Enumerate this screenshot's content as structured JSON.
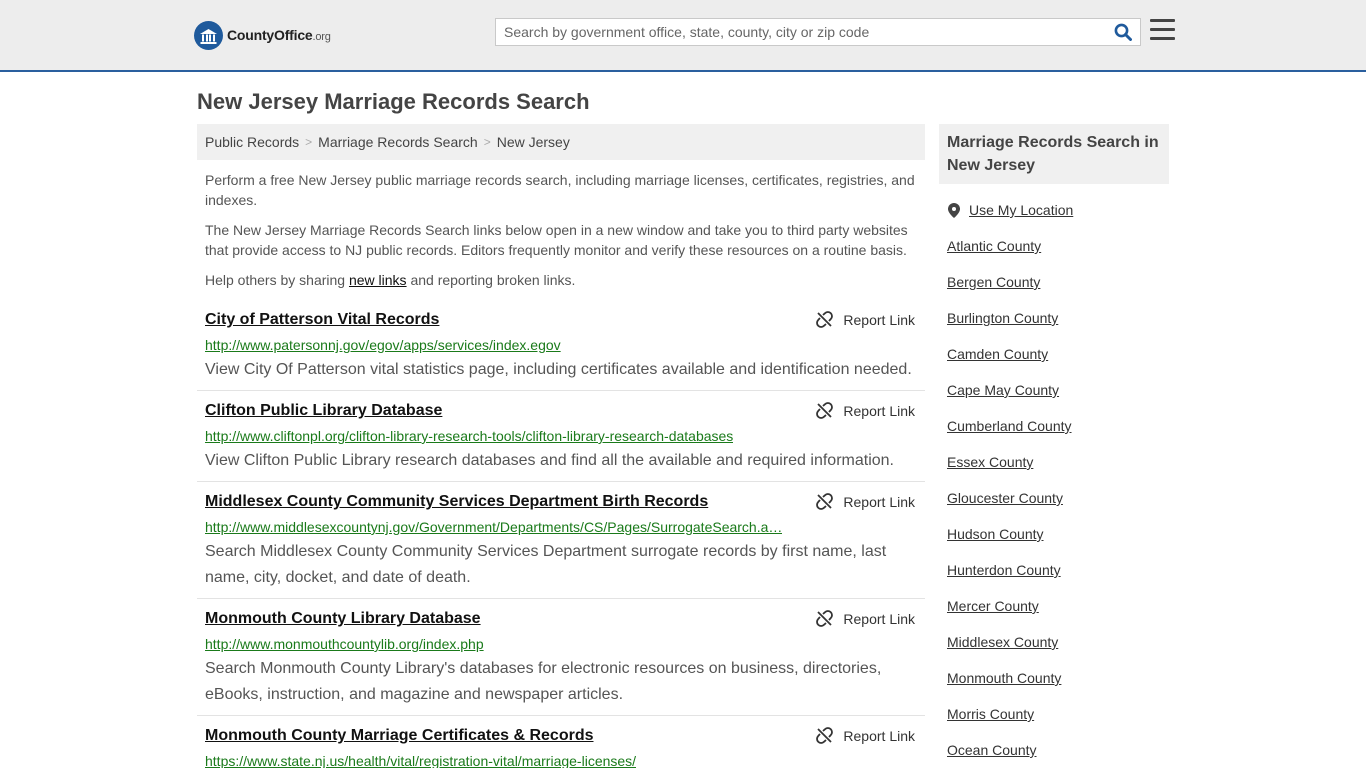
{
  "header": {
    "logo_name": "CountyOffice",
    "logo_tld": ".org",
    "search_placeholder": "Search by government office, state, county, city or zip code"
  },
  "page": {
    "title": "New Jersey Marriage Records Search"
  },
  "breadcrumb": [
    "Public Records",
    "Marriage Records Search",
    "New Jersey"
  ],
  "intro": {
    "p1": "Perform a free New Jersey public marriage records search, including marriage licenses, certificates, registries, and indexes.",
    "p2": "The New Jersey Marriage Records Search links below open in a new window and take you to third party websites that provide access to NJ public records. Editors frequently monitor and verify these resources on a routine basis.",
    "p3_before": "Help others by sharing ",
    "p3_link": "new links",
    "p3_after": " and reporting broken links."
  },
  "report_label": "Report Link",
  "listings": [
    {
      "title": "City of Patterson Vital Records",
      "url": "http://www.patersonnj.gov/egov/apps/services/index.egov",
      "desc": "View City Of Patterson vital statistics page, including certificates available and identification needed."
    },
    {
      "title": "Clifton Public Library Database",
      "url": "http://www.cliftonpl.org/clifton-library-research-tools/clifton-library-research-databases",
      "desc": "View Clifton Public Library research databases and find all the available and required information."
    },
    {
      "title": "Middlesex County Community Services Department Birth Records",
      "url": "http://www.middlesexcountynj.gov/Government/Departments/CS/Pages/SurrogateSearch.a…",
      "desc": "Search Middlesex County Community Services Department surrogate records by first name, last name, city, docket, and date of death."
    },
    {
      "title": "Monmouth County Library Database",
      "url": "http://www.monmouthcountylib.org/index.php",
      "desc": "Search Monmouth County Library's databases for electronic resources on business, directories, eBooks, instruction, and magazine and newspaper articles."
    },
    {
      "title": "Monmouth County Marriage Certificates & Records",
      "url": "https://www.state.nj.us/health/vital/registration-vital/marriage-licenses/",
      "desc": ""
    }
  ],
  "sidebar": {
    "heading": "Marriage Records Search in New Jersey",
    "use_location": "Use My Location",
    "counties": [
      "Atlantic County",
      "Bergen County",
      "Burlington County",
      "Camden County",
      "Cape May County",
      "Cumberland County",
      "Essex County",
      "Gloucester County",
      "Hudson County",
      "Hunterdon County",
      "Mercer County",
      "Middlesex County",
      "Monmouth County",
      "Morris County",
      "Ocean County"
    ]
  },
  "colors": {
    "header_bg": "#ededed",
    "header_border": "#2a5f9e",
    "url_green": "#1a7a1a",
    "search_icon": "#1f5a9c"
  }
}
